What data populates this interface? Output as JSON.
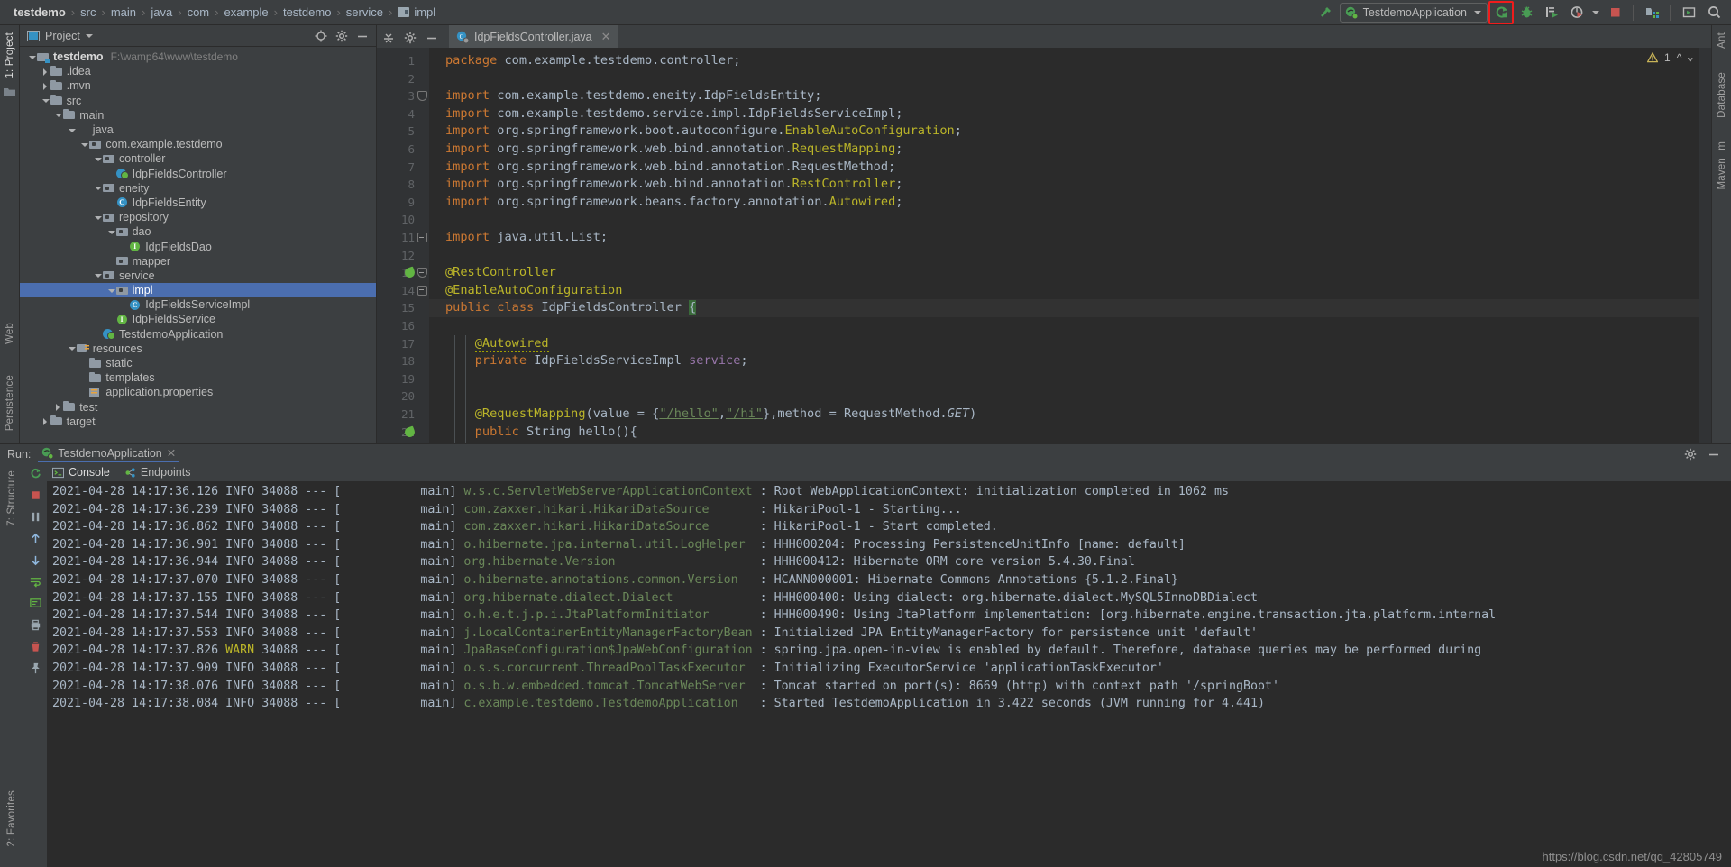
{
  "breadcrumb": {
    "items": [
      "testdemo",
      "src",
      "main",
      "java",
      "com",
      "example",
      "testdemo",
      "service",
      "impl"
    ],
    "separator": "›"
  },
  "toolbar": {
    "make_icon": "hammer-icon",
    "run_config": "TestdemoApplication",
    "run_config_icon": "spring-boot-icon",
    "rerun_label": "rerun-icon",
    "debug_label": "debug-icon",
    "run_coverage_label": "run-with-coverage-icon",
    "profile_label": "profiler-icon",
    "stop_label": "stop-icon",
    "db_label": "open-in-browser-icon",
    "layout_label": "layout-icon",
    "search_label": "search-icon",
    "highlight_color": "#f01c1c",
    "accent_green": "#499c54",
    "accent_red": "#c75450"
  },
  "left_strip": {
    "project_label": "1: Project",
    "structure_label": "7: Structure",
    "favorites_label": "2: Favorites",
    "web_label": "Web",
    "persistence_label": "Persistence"
  },
  "right_strip": {
    "ant_label": "Ant",
    "database_label": "Database",
    "maven_label": "Maven",
    "maven_prefix": "m"
  },
  "project_panel": {
    "title": "Project",
    "locate_icon": "locate-icon",
    "settings_icon": "gear-icon",
    "hide_icon": "minimize-icon",
    "tree": [
      {
        "label": "testdemo",
        "sub": "F:\\wamp64\\www\\testdemo",
        "depth": 0,
        "arrow": "down",
        "icon": "mod",
        "bold": true,
        "sel": false
      },
      {
        "label": ".idea",
        "sub": "",
        "depth": 1,
        "arrow": "right",
        "icon": "folder",
        "bold": false,
        "sel": false
      },
      {
        "label": ".mvn",
        "sub": "",
        "depth": 1,
        "arrow": "right",
        "icon": "folder",
        "bold": false,
        "sel": false
      },
      {
        "label": "src",
        "sub": "",
        "depth": 1,
        "arrow": "down",
        "icon": "folder",
        "bold": false,
        "sel": false
      },
      {
        "label": "main",
        "sub": "",
        "depth": 2,
        "arrow": "down",
        "icon": "folder",
        "bold": false,
        "sel": false
      },
      {
        "label": "java",
        "sub": "",
        "depth": 3,
        "arrow": "down",
        "icon": "folder-blue",
        "bold": false,
        "sel": false
      },
      {
        "label": "com.example.testdemo",
        "sub": "",
        "depth": 4,
        "arrow": "down",
        "icon": "pkg",
        "bold": false,
        "sel": false
      },
      {
        "label": "controller",
        "sub": "",
        "depth": 5,
        "arrow": "down",
        "icon": "pkg",
        "bold": false,
        "sel": false
      },
      {
        "label": "IdpFieldsController",
        "sub": "",
        "depth": 6,
        "arrow": "none",
        "icon": "spring",
        "bold": false,
        "sel": false
      },
      {
        "label": "eneity",
        "sub": "",
        "depth": 5,
        "arrow": "down",
        "icon": "pkg",
        "bold": false,
        "sel": false
      },
      {
        "label": "IdpFieldsEntity",
        "sub": "",
        "depth": 6,
        "arrow": "none",
        "icon": "cls",
        "bold": false,
        "sel": false
      },
      {
        "label": "repository",
        "sub": "",
        "depth": 5,
        "arrow": "down",
        "icon": "pkg",
        "bold": false,
        "sel": false
      },
      {
        "label": "dao",
        "sub": "",
        "depth": 6,
        "arrow": "down",
        "icon": "pkg",
        "bold": false,
        "sel": false
      },
      {
        "label": "IdpFieldsDao",
        "sub": "",
        "depth": 7,
        "arrow": "none",
        "icon": "iface",
        "bold": false,
        "sel": false
      },
      {
        "label": "mapper",
        "sub": "",
        "depth": 6,
        "arrow": "none",
        "icon": "pkg",
        "bold": false,
        "sel": false
      },
      {
        "label": "service",
        "sub": "",
        "depth": 5,
        "arrow": "down",
        "icon": "pkg",
        "bold": false,
        "sel": false
      },
      {
        "label": "impl",
        "sub": "",
        "depth": 6,
        "arrow": "down",
        "icon": "pkg",
        "bold": false,
        "sel": true
      },
      {
        "label": "IdpFieldsServiceImpl",
        "sub": "",
        "depth": 7,
        "arrow": "none",
        "icon": "cls",
        "bold": false,
        "sel": false
      },
      {
        "label": "IdpFieldsService",
        "sub": "",
        "depth": 6,
        "arrow": "none",
        "icon": "iface",
        "bold": false,
        "sel": false
      },
      {
        "label": "TestdemoApplication",
        "sub": "",
        "depth": 5,
        "arrow": "none",
        "icon": "spring",
        "bold": false,
        "sel": false
      },
      {
        "label": "resources",
        "sub": "",
        "depth": 3,
        "arrow": "down",
        "icon": "res",
        "bold": false,
        "sel": false
      },
      {
        "label": "static",
        "sub": "",
        "depth": 4,
        "arrow": "none",
        "icon": "folder",
        "bold": false,
        "sel": false
      },
      {
        "label": "templates",
        "sub": "",
        "depth": 4,
        "arrow": "none",
        "icon": "folder",
        "bold": false,
        "sel": false
      },
      {
        "label": "application.properties",
        "sub": "",
        "depth": 4,
        "arrow": "none",
        "icon": "props",
        "bold": false,
        "sel": false
      },
      {
        "label": "test",
        "sub": "",
        "depth": 2,
        "arrow": "right",
        "icon": "folder",
        "bold": false,
        "sel": false
      },
      {
        "label": "target",
        "sub": "",
        "depth": 1,
        "arrow": "right",
        "icon": "folder",
        "bold": false,
        "sel": false
      }
    ]
  },
  "editor": {
    "tab_title": "IdpFieldsController.java",
    "tab_icon": "spring-class-icon",
    "close_icon": "close-icon",
    "warning_count": "1",
    "warning_icon": "warning-icon",
    "up_icon": "chevron-up-icon",
    "down_icon": "chevron-down-icon",
    "caret_line": 15,
    "lines": [
      {
        "n": 1,
        "html": "<span class='k'>package</span> <span class='plain'>com.example.testdemo.controller;</span>"
      },
      {
        "n": 2,
        "html": ""
      },
      {
        "n": 3,
        "html": "<span class='k'>import</span> <span class='plain'>com.example.testdemo.eneity.IdpFieldsEntity;</span>",
        "fold": "open"
      },
      {
        "n": 4,
        "html": "<span class='k'>import</span> <span class='plain'>com.example.testdemo.service.impl.IdpFieldsServiceImpl;</span>"
      },
      {
        "n": 5,
        "html": "<span class='k'>import</span> <span class='plain'>org.springframework.boot.autoconfigure.</span><span class='ann'>EnableAutoConfiguration</span><span class='plain'>;</span>"
      },
      {
        "n": 6,
        "html": "<span class='k'>import</span> <span class='plain'>org.springframework.web.bind.annotation.</span><span class='ann'>RequestMapping</span><span class='plain'>;</span>"
      },
      {
        "n": 7,
        "html": "<span class='k'>import</span> <span class='plain'>org.springframework.web.bind.annotation.RequestMethod;</span>"
      },
      {
        "n": 8,
        "html": "<span class='k'>import</span> <span class='plain'>org.springframework.web.bind.annotation.</span><span class='ann'>RestController</span><span class='plain'>;</span>"
      },
      {
        "n": 9,
        "html": "<span class='k'>import</span> <span class='plain'>org.springframework.beans.factory.annotation.</span><span class='ann'>Autowired</span><span class='plain'>;</span>"
      },
      {
        "n": 10,
        "html": ""
      },
      {
        "n": 11,
        "html": "<span class='k'>import</span> <span class='plain'>java.util.List;</span>",
        "fold": "closed"
      },
      {
        "n": 12,
        "html": ""
      },
      {
        "n": 13,
        "html": "<span class='ann'>@RestController</span>",
        "fold": "open",
        "gutter_icon": "spring-bean-icon"
      },
      {
        "n": 14,
        "html": "<span class='ann'>@EnableAutoConfiguration</span>",
        "fold": "closed"
      },
      {
        "n": 15,
        "html": "<span class='k'>public class</span> <span class='cls2'>IdpFieldsController</span> <span class='greenb'>{</span>"
      },
      {
        "n": 16,
        "html": ""
      },
      {
        "n": 17,
        "html": "    <span class='ann squig'>@Autowired</span>"
      },
      {
        "n": 18,
        "html": "    <span class='k'>private</span> <span class='cls2'>IdpFieldsServiceImpl</span> <span class='fld'>service</span><span class='plain'>;</span>"
      },
      {
        "n": 19,
        "html": ""
      },
      {
        "n": 20,
        "html": ""
      },
      {
        "n": 21,
        "html": "    <span class='ann'>@RequestMapping</span><span class='plain'>(value = {</span><span class='strlink'>\"/hello\"</span><span class='plain'>,</span><span class='strlink'>\"/hi\"</span><span class='plain'>},method = RequestMethod.</span><span class='stat'>GET</span><span class='plain'>)</span>"
      },
      {
        "n": 22,
        "html": "    <span class='k'>public</span> <span class='cls2'>String</span> <span class='plain'>hello(){</span>",
        "gutter_icon": "spring-bean-icon"
      }
    ]
  },
  "run_panel": {
    "run_label": "Run:",
    "tab_title": "TestdemoApplication",
    "tab_icon": "spring-boot-icon",
    "close_icon": "close-icon",
    "gear_icon": "gear-icon",
    "hide_icon": "minimize-icon",
    "subtabs": [
      {
        "label": "Console",
        "icon": "console-icon",
        "active": true
      },
      {
        "label": "Endpoints",
        "icon": "endpoints-icon",
        "active": false
      }
    ],
    "side_icons": [
      "rerun-icon",
      "stop-icon",
      "pause-icon",
      "scroll-up-icon",
      "scroll-down-icon",
      "soft-wrap-icon",
      "scroll-end-icon",
      "print-icon",
      "trash-icon",
      "pin-icon",
      "settings-icon"
    ],
    "log_lines": [
      {
        "ts": "2021-04-28 14:17:36.126",
        "lvl": "INFO",
        "pid": "34088",
        "thread": "main",
        "logger": "w.s.c.ServletWebServerApplicationContext",
        "msg": "Root WebApplicationContext: initialization completed in 1062 ms"
      },
      {
        "ts": "2021-04-28 14:17:36.239",
        "lvl": "INFO",
        "pid": "34088",
        "thread": "main",
        "logger": "com.zaxxer.hikari.HikariDataSource",
        "msg": "HikariPool-1 - Starting..."
      },
      {
        "ts": "2021-04-28 14:17:36.862",
        "lvl": "INFO",
        "pid": "34088",
        "thread": "main",
        "logger": "com.zaxxer.hikari.HikariDataSource",
        "msg": "HikariPool-1 - Start completed."
      },
      {
        "ts": "2021-04-28 14:17:36.901",
        "lvl": "INFO",
        "pid": "34088",
        "thread": "main",
        "logger": "o.hibernate.jpa.internal.util.LogHelper",
        "msg": "HHH000204: Processing PersistenceUnitInfo [name: default]"
      },
      {
        "ts": "2021-04-28 14:17:36.944",
        "lvl": "INFO",
        "pid": "34088",
        "thread": "main",
        "logger": "org.hibernate.Version",
        "msg": "HHH000412: Hibernate ORM core version 5.4.30.Final"
      },
      {
        "ts": "2021-04-28 14:17:37.070",
        "lvl": "INFO",
        "pid": "34088",
        "thread": "main",
        "logger": "o.hibernate.annotations.common.Version",
        "msg": "HCANN000001: Hibernate Commons Annotations {5.1.2.Final}"
      },
      {
        "ts": "2021-04-28 14:17:37.155",
        "lvl": "INFO",
        "pid": "34088",
        "thread": "main",
        "logger": "org.hibernate.dialect.Dialect",
        "msg": "HHH000400: Using dialect: org.hibernate.dialect.MySQL5InnoDBDialect"
      },
      {
        "ts": "2021-04-28 14:17:37.544",
        "lvl": "INFO",
        "pid": "34088",
        "thread": "main",
        "logger": "o.h.e.t.j.p.i.JtaPlatformInitiator",
        "msg": "HHH000490: Using JtaPlatform implementation: [org.hibernate.engine.transaction.jta.platform.internal"
      },
      {
        "ts": "2021-04-28 14:17:37.553",
        "lvl": "INFO",
        "pid": "34088",
        "thread": "main",
        "logger": "j.LocalContainerEntityManagerFactoryBean",
        "msg": "Initialized JPA EntityManagerFactory for persistence unit 'default'"
      },
      {
        "ts": "2021-04-28 14:17:37.826",
        "lvl": "WARN",
        "pid": "34088",
        "thread": "main",
        "logger": "JpaBaseConfiguration$JpaWebConfiguration",
        "msg": "spring.jpa.open-in-view is enabled by default. Therefore, database queries may be performed during"
      },
      {
        "ts": "2021-04-28 14:17:37.909",
        "lvl": "INFO",
        "pid": "34088",
        "thread": "main",
        "logger": "o.s.s.concurrent.ThreadPoolTaskExecutor",
        "msg": "Initializing ExecutorService 'applicationTaskExecutor'"
      },
      {
        "ts": "2021-04-28 14:17:38.076",
        "lvl": "INFO",
        "pid": "34088",
        "thread": "main",
        "logger": "o.s.b.w.embedded.tomcat.TomcatWebServer",
        "msg": "Tomcat started on port(s): 8669 (http) with context path '/springBoot'"
      },
      {
        "ts": "2021-04-28 14:17:38.084",
        "lvl": "INFO",
        "pid": "34088",
        "thread": "main",
        "logger": "c.example.testdemo.TestdemoApplication",
        "msg": "Started TestdemoApplication in 3.422 seconds (JVM running for 4.441)"
      }
    ]
  },
  "watermark": "https://blog.csdn.net/qq_42805749"
}
